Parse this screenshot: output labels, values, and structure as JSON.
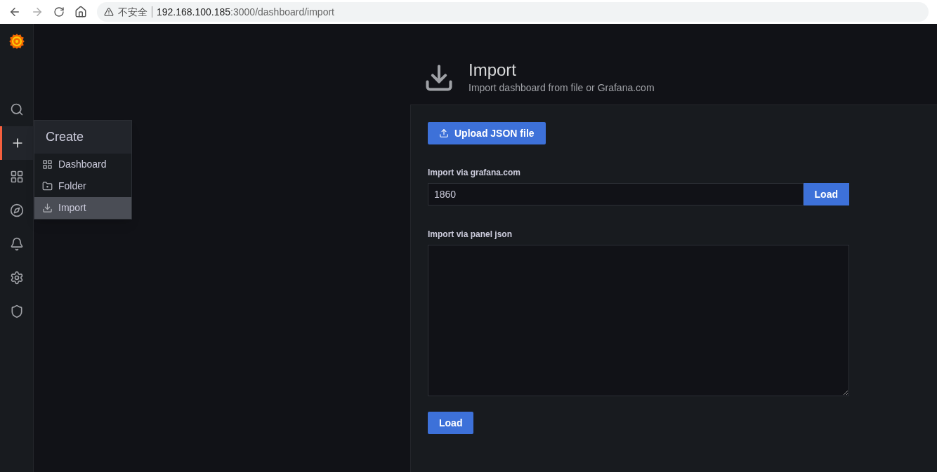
{
  "browser": {
    "security_label": "不安全",
    "url_host": "192.168.100.185",
    "url_path": ":3000/dashboard/import"
  },
  "sidebar": {
    "items": [
      {
        "kind": "search",
        "selected": false
      },
      {
        "kind": "create",
        "selected": true
      },
      {
        "kind": "dashboards",
        "selected": false
      },
      {
        "kind": "explore",
        "selected": false
      },
      {
        "kind": "alerting",
        "selected": false
      },
      {
        "kind": "configuration",
        "selected": false
      },
      {
        "kind": "admin",
        "selected": false
      }
    ]
  },
  "create_menu": {
    "title": "Create",
    "items": [
      {
        "kind": "dashboard",
        "label": "Dashboard",
        "selected": false
      },
      {
        "kind": "folder",
        "label": "Folder",
        "selected": false
      },
      {
        "kind": "import",
        "label": "Import",
        "selected": true
      }
    ]
  },
  "header": {
    "title": "Import",
    "subtitle": "Import dashboard from file or Grafana.com"
  },
  "form": {
    "upload_button": "Upload JSON file",
    "grafana_com": {
      "label": "Import via grafana.com",
      "value": "1860",
      "button": "Load"
    },
    "panel_json": {
      "label": "Import via panel json",
      "button": "Load"
    }
  }
}
